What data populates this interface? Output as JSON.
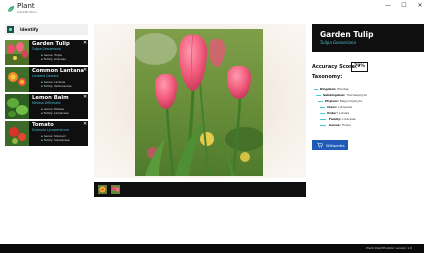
{
  "app": {
    "title": "Plant",
    "subtitle": "Identification",
    "window_controls": {
      "minimize": "—",
      "maximize": "☐",
      "close": "✕"
    }
  },
  "identify": {
    "label": "Identify"
  },
  "history": [
    {
      "name": "Garden Tulip",
      "scientific": "Tulipa Gesneriana",
      "genus_label": "Genus:",
      "genus": "Tulipa",
      "family_label": "Family:",
      "family": "Liliaceae"
    },
    {
      "name": "Common Lantana",
      "scientific": "Lantana Camara",
      "genus_label": "Genus:",
      "genus": "Lantana",
      "family_label": "Family:",
      "family": "Verbenaceae"
    },
    {
      "name": "Lemon Balm",
      "scientific": "Melissa Officinalis",
      "genus_label": "Genus:",
      "genus": "Melissa",
      "family_label": "Family:",
      "family": "Lamiaceae"
    },
    {
      "name": "Tomato",
      "scientific": "Solanum Lycopersicum",
      "genus_label": "Genus:",
      "genus": "Solanum",
      "family_label": "Family:",
      "family": "Solanaceae"
    }
  ],
  "result": {
    "name": "Garden Tulip",
    "scientific": "Tulipa Gesneriana",
    "accuracy_label": "Accuracy Score:",
    "accuracy": "79%",
    "taxonomy_label": "Taxonomy:",
    "taxonomy": [
      {
        "rank": "Kingdom:",
        "value": "Plantae"
      },
      {
        "rank": "Subkingdom:",
        "value": "Tracheophyta"
      },
      {
        "rank": "Phylum:",
        "value": "Magnoliophyta"
      },
      {
        "rank": "Class:",
        "value": "Liliopsida"
      },
      {
        "rank": "Order:",
        "value": "Liliales"
      },
      {
        "rank": "Family:",
        "value": "Liliaceae"
      },
      {
        "rank": "Genus:",
        "value": "Tulipa"
      }
    ],
    "wiki_label": "Wikipedia"
  },
  "status": {
    "version": "Plant Identification version 1.0"
  },
  "colors": {
    "accent": "#4ec4d8",
    "dark": "#0f0f0f",
    "wiki": "#1e5ab8"
  }
}
